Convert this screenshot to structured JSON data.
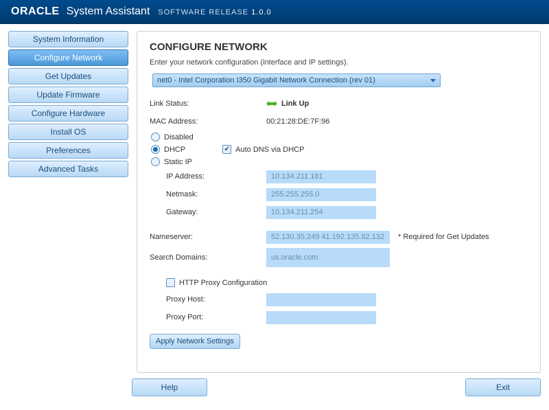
{
  "header": {
    "logo": "ORACLE",
    "product": "System Assistant",
    "release_label": "SOFTWARE RELEASE",
    "release_version": "1.0.0"
  },
  "sidebar": {
    "items": [
      {
        "label": "System Information",
        "active": false
      },
      {
        "label": "Configure Network",
        "active": true
      },
      {
        "label": "Get Updates",
        "active": false
      },
      {
        "label": "Update Firmware",
        "active": false
      },
      {
        "label": "Configure Hardware",
        "active": false
      },
      {
        "label": "Install OS",
        "active": false
      },
      {
        "label": "Preferences",
        "active": false
      },
      {
        "label": "Advanced Tasks",
        "active": false
      }
    ]
  },
  "content": {
    "title": "CONFIGURE NETWORK",
    "subtitle": "Enter your network configuration (interface and IP settings).",
    "interface_selected": "net0 - Intel Corporation I350 Gigabit Network Connection (rev 01)",
    "link_status_label": "Link Status:",
    "link_status_value": "Link Up",
    "mac_label": "MAC Address:",
    "mac_value": "00:21:28:DE:7F:96",
    "mode": {
      "disabled": "Disabled",
      "dhcp": "DHCP",
      "static": "Static IP",
      "selected": "DHCP"
    },
    "auto_dns_label": "Auto DNS via DHCP",
    "ip": {
      "ip_label": "IP Address:",
      "ip_value": "10.134.211.181",
      "netmask_label": "Netmask:",
      "netmask_value": "255.255.255.0",
      "gateway_label": "Gateway:",
      "gateway_value": "10.134.211.254"
    },
    "dns": {
      "nameserver_label": "Nameserver:",
      "nameserver_value": "52.130.35.249 41.192.135.82.132",
      "nameserver_note": "* Required for Get Updates",
      "search_label": "Search Domains:",
      "search_value": "us.oracle.com"
    },
    "proxy": {
      "checkbox_label": "HTTP Proxy Configuration",
      "host_label": "Proxy Host:",
      "host_value": "",
      "port_label": "Proxy Port:",
      "port_value": ""
    },
    "apply_label": "Apply Network Settings"
  },
  "footer": {
    "help": "Help",
    "exit": "Exit"
  }
}
